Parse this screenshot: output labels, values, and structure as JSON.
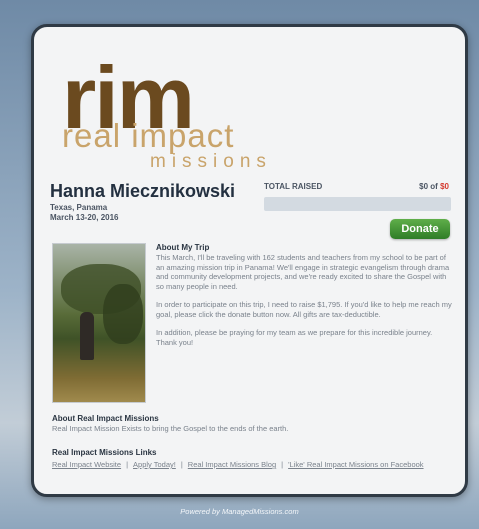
{
  "logo": {
    "main": "rim",
    "line2": "real impact",
    "line3": "missions"
  },
  "profile": {
    "name": "Hanna Miecznikowski",
    "location": "Texas, Panama",
    "dates": "March 13-20, 2016"
  },
  "fundraising": {
    "label": "TOTAL RAISED",
    "raised": "$0",
    "of": "of",
    "goal": "$0",
    "progress_fraction": 0,
    "donate_label": "Donate",
    "colors": {
      "fill": "#5d9b43",
      "goal": "#d43a2f"
    }
  },
  "about_trip": {
    "title": "About My Trip",
    "paragraphs": [
      "This March, I'll be traveling with 162 students and teachers from my school to be part of an amazing mission trip in Panama! We'll engage in strategic evangelism through drama and community development projects, and we're ready excited to share the Gospel with so many people in need.",
      "In order to participate on this trip, I need to raise $1,795. If you'd like to help me reach my goal, please click the donate button now. All gifts are tax-deductible.",
      "In addition, please be praying for my team as we prepare for this incredible journey. Thank you!"
    ]
  },
  "about_rim": {
    "title": "About Real Impact Missions",
    "text": "Real Impact Mission Exists to bring the Gospel to the ends of the earth."
  },
  "links": {
    "title": "Real Impact Missions Links",
    "items": [
      "Real Impact Website",
      "Apply Today!",
      "Real Impact Missions Blog",
      "'Like' Real Impact Missions on Facebook"
    ],
    "separator": "|"
  },
  "footer": {
    "text": "Powered by ManagedMissions.com"
  }
}
